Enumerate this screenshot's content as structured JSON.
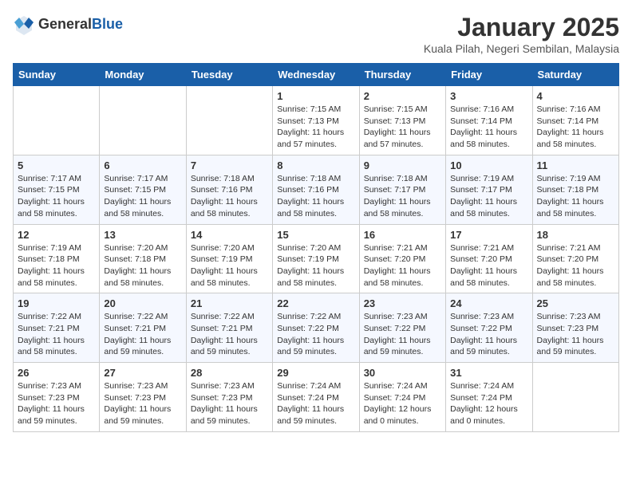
{
  "header": {
    "logo_general": "General",
    "logo_blue": "Blue",
    "month_title": "January 2025",
    "location": "Kuala Pilah, Negeri Sembilan, Malaysia"
  },
  "weekdays": [
    "Sunday",
    "Monday",
    "Tuesday",
    "Wednesday",
    "Thursday",
    "Friday",
    "Saturday"
  ],
  "weeks": [
    [
      {
        "day": "",
        "info": ""
      },
      {
        "day": "",
        "info": ""
      },
      {
        "day": "",
        "info": ""
      },
      {
        "day": "1",
        "info": "Sunrise: 7:15 AM\nSunset: 7:13 PM\nDaylight: 11 hours and 57 minutes."
      },
      {
        "day": "2",
        "info": "Sunrise: 7:15 AM\nSunset: 7:13 PM\nDaylight: 11 hours and 57 minutes."
      },
      {
        "day": "3",
        "info": "Sunrise: 7:16 AM\nSunset: 7:14 PM\nDaylight: 11 hours and 58 minutes."
      },
      {
        "day": "4",
        "info": "Sunrise: 7:16 AM\nSunset: 7:14 PM\nDaylight: 11 hours and 58 minutes."
      }
    ],
    [
      {
        "day": "5",
        "info": "Sunrise: 7:17 AM\nSunset: 7:15 PM\nDaylight: 11 hours and 58 minutes."
      },
      {
        "day": "6",
        "info": "Sunrise: 7:17 AM\nSunset: 7:15 PM\nDaylight: 11 hours and 58 minutes."
      },
      {
        "day": "7",
        "info": "Sunrise: 7:18 AM\nSunset: 7:16 PM\nDaylight: 11 hours and 58 minutes."
      },
      {
        "day": "8",
        "info": "Sunrise: 7:18 AM\nSunset: 7:16 PM\nDaylight: 11 hours and 58 minutes."
      },
      {
        "day": "9",
        "info": "Sunrise: 7:18 AM\nSunset: 7:17 PM\nDaylight: 11 hours and 58 minutes."
      },
      {
        "day": "10",
        "info": "Sunrise: 7:19 AM\nSunset: 7:17 PM\nDaylight: 11 hours and 58 minutes."
      },
      {
        "day": "11",
        "info": "Sunrise: 7:19 AM\nSunset: 7:18 PM\nDaylight: 11 hours and 58 minutes."
      }
    ],
    [
      {
        "day": "12",
        "info": "Sunrise: 7:19 AM\nSunset: 7:18 PM\nDaylight: 11 hours and 58 minutes."
      },
      {
        "day": "13",
        "info": "Sunrise: 7:20 AM\nSunset: 7:18 PM\nDaylight: 11 hours and 58 minutes."
      },
      {
        "day": "14",
        "info": "Sunrise: 7:20 AM\nSunset: 7:19 PM\nDaylight: 11 hours and 58 minutes."
      },
      {
        "day": "15",
        "info": "Sunrise: 7:20 AM\nSunset: 7:19 PM\nDaylight: 11 hours and 58 minutes."
      },
      {
        "day": "16",
        "info": "Sunrise: 7:21 AM\nSunset: 7:20 PM\nDaylight: 11 hours and 58 minutes."
      },
      {
        "day": "17",
        "info": "Sunrise: 7:21 AM\nSunset: 7:20 PM\nDaylight: 11 hours and 58 minutes."
      },
      {
        "day": "18",
        "info": "Sunrise: 7:21 AM\nSunset: 7:20 PM\nDaylight: 11 hours and 58 minutes."
      }
    ],
    [
      {
        "day": "19",
        "info": "Sunrise: 7:22 AM\nSunset: 7:21 PM\nDaylight: 11 hours and 58 minutes."
      },
      {
        "day": "20",
        "info": "Sunrise: 7:22 AM\nSunset: 7:21 PM\nDaylight: 11 hours and 59 minutes."
      },
      {
        "day": "21",
        "info": "Sunrise: 7:22 AM\nSunset: 7:21 PM\nDaylight: 11 hours and 59 minutes."
      },
      {
        "day": "22",
        "info": "Sunrise: 7:22 AM\nSunset: 7:22 PM\nDaylight: 11 hours and 59 minutes."
      },
      {
        "day": "23",
        "info": "Sunrise: 7:23 AM\nSunset: 7:22 PM\nDaylight: 11 hours and 59 minutes."
      },
      {
        "day": "24",
        "info": "Sunrise: 7:23 AM\nSunset: 7:22 PM\nDaylight: 11 hours and 59 minutes."
      },
      {
        "day": "25",
        "info": "Sunrise: 7:23 AM\nSunset: 7:23 PM\nDaylight: 11 hours and 59 minutes."
      }
    ],
    [
      {
        "day": "26",
        "info": "Sunrise: 7:23 AM\nSunset: 7:23 PM\nDaylight: 11 hours and 59 minutes."
      },
      {
        "day": "27",
        "info": "Sunrise: 7:23 AM\nSunset: 7:23 PM\nDaylight: 11 hours and 59 minutes."
      },
      {
        "day": "28",
        "info": "Sunrise: 7:23 AM\nSunset: 7:23 PM\nDaylight: 11 hours and 59 minutes."
      },
      {
        "day": "29",
        "info": "Sunrise: 7:24 AM\nSunset: 7:24 PM\nDaylight: 11 hours and 59 minutes."
      },
      {
        "day": "30",
        "info": "Sunrise: 7:24 AM\nSunset: 7:24 PM\nDaylight: 12 hours and 0 minutes."
      },
      {
        "day": "31",
        "info": "Sunrise: 7:24 AM\nSunset: 7:24 PM\nDaylight: 12 hours and 0 minutes."
      },
      {
        "day": "",
        "info": ""
      }
    ]
  ]
}
